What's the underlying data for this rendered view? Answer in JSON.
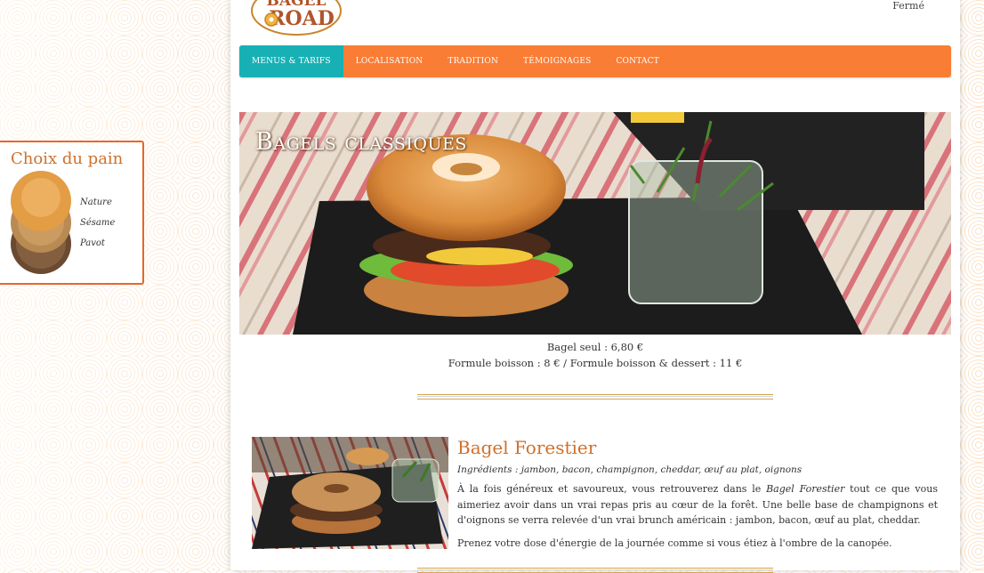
{
  "header": {
    "logo_line1": "BAGEL",
    "logo_line2": "ROAD",
    "status": "Fermé"
  },
  "nav": {
    "items": [
      {
        "label": "MENUS & TARIFS",
        "active": true
      },
      {
        "label": "LOCALISATION",
        "active": false
      },
      {
        "label": "TRADITION",
        "active": false
      },
      {
        "label": "TÉMOIGNAGES",
        "active": false
      },
      {
        "label": "CONTACT",
        "active": false
      }
    ]
  },
  "hero": {
    "title": "Bagels classiques"
  },
  "pricing": {
    "line1": "Bagel seul : 6,80 €",
    "line2": "Formule boisson : 8 € / Formule boisson & dessert : 11 €"
  },
  "item": {
    "title": "Bagel Forestier",
    "ingredients": "Ingrédients : jambon, bacon, champignon, cheddar, œuf au plat, oignons",
    "desc_part1": "À la fois généreux et savoureux, vous retrouverez dans le ",
    "desc_em": "Bagel Forestier",
    "desc_part2": " tout ce que vous aimeriez avoir dans un vrai repas pris au cœur de la forêt. Une belle base de champignons et d'oignons se verra relevée d'un vrai brunch américain : jambon, bacon, œuf au plat, cheddar.",
    "desc2": "Prenez votre dose d'énergie de la journée comme si vous étiez à l'ombre de la canopée."
  },
  "sidebar": {
    "title": "Choix du pain",
    "breads": [
      {
        "label": "Nature"
      },
      {
        "label": "Sésame"
      },
      {
        "label": "Pavot"
      }
    ]
  },
  "colors": {
    "nav": "#f97d34",
    "nav_active": "#17b1b5",
    "accent_title": "#d0702a",
    "sidebar_border": "#e9662b"
  }
}
